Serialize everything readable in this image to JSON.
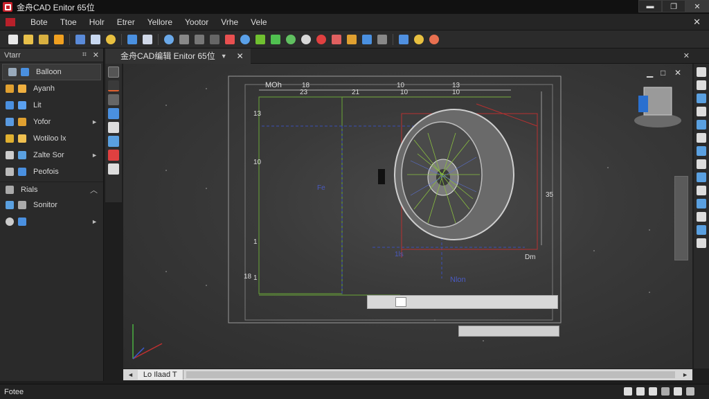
{
  "window": {
    "title": "金舟CAD Enitor 65位",
    "minimize": "▬",
    "maximize": "❐",
    "close": "✕"
  },
  "menu": {
    "items": [
      "Bote",
      "Ttoe",
      "Holr",
      "Etrer",
      "Yellore",
      "Yootor",
      "Vrhe",
      "Vele"
    ],
    "close": "✕"
  },
  "left_panel": {
    "header": "Vtarr",
    "pin": "⌗",
    "close": "✕",
    "rows": [
      {
        "label": "Balloon",
        "active": true,
        "arrow": ""
      },
      {
        "label": "Ayanh",
        "arrow": ""
      },
      {
        "label": "Lit",
        "arrow": ""
      },
      {
        "label": "Yofor",
        "arrow": "►"
      },
      {
        "label": "Wotiloo lx",
        "arrow": ""
      },
      {
        "label": "Zalte Sor",
        "arrow": "►"
      },
      {
        "label": "Peofois",
        "arrow": ""
      }
    ],
    "section": {
      "label": "Rials",
      "chevron": "︿"
    },
    "rows2": [
      {
        "label": "Sonitor",
        "arrow": ""
      },
      {
        "label": "",
        "arrow": "►"
      }
    ]
  },
  "doc_tabs": {
    "tab_label": "金舟CAD编辑 Enitor 65位",
    "arrow": "▼",
    "tab_close": "✕",
    "panel_close": "✕"
  },
  "viewport": {
    "minimize": "▁",
    "restore": "□",
    "close": "✕"
  },
  "drawing": {
    "dim_labels": [
      "MOh",
      "18",
      "10",
      "13"
    ],
    "dim_numbers": [
      "23",
      "21",
      "10",
      "10"
    ],
    "left_labels": [
      "13",
      "10",
      "1",
      "1",
      "18"
    ],
    "side_label": "Fe",
    "bottom_blue_label": "1ls",
    "right_label": "Dm",
    "right_side": "35",
    "blue_bottom": "Nlon"
  },
  "bottom_tabs": {
    "layout": "Lo Ilaad T",
    "arrow_left": "◄",
    "arrow_right": "►"
  },
  "status": {
    "left": "Fotee"
  },
  "colors": {
    "accent_red": "#c8202a",
    "title_bg": "#111111",
    "panel_bg": "#2a2a2a",
    "canvas_center": "#4a4a4a"
  }
}
